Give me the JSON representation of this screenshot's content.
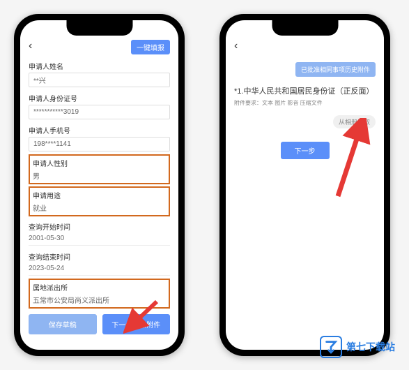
{
  "phone1": {
    "fill_btn": "一键填报",
    "fields": {
      "name_label": "申请人姓名",
      "name_value": "**兴",
      "id_label": "申请人身份证号",
      "id_value": "***********3019",
      "phone_label": "申请人手机号",
      "phone_value": "198****1141",
      "gender_label": "申请人性别",
      "gender_value": "男",
      "purpose_label": "申请用途",
      "purpose_value": "就业",
      "start_label": "查询开始时间",
      "start_value": "2001-05-30",
      "end_label": "查询结束时间",
      "end_value": "2023-05-24",
      "station_label": "属地派出所",
      "station_value": "五常市公安局尚义派出所"
    },
    "buttons": {
      "save_draft": "保存草稿",
      "next_attach": "下一步添加附件"
    }
  },
  "phone2": {
    "history_btn": "已批准相同事项历史附件",
    "doc_title": "*1.中华人民共和国居民身份证（正反面）",
    "doc_req": "附件要求：文本 图片 影音 压缩文件",
    "select_btn": "从相册选取",
    "next_btn": "下一步"
  },
  "watermark": {
    "icon": "7",
    "text": "第七下载站"
  }
}
